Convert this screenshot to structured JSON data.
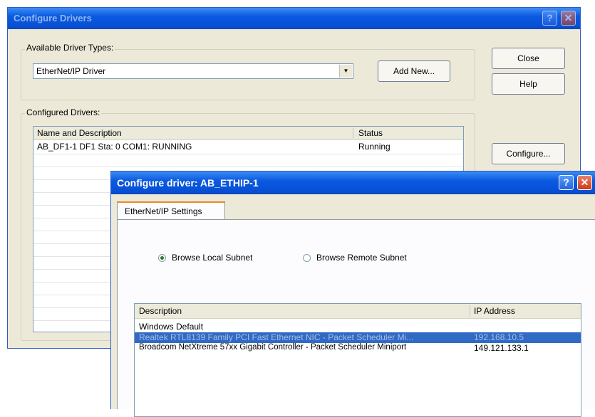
{
  "back_window": {
    "title": "Configure Drivers",
    "available_label": "Available Driver Types:",
    "driver_type_value": "EtherNet/IP Driver",
    "add_new_label": "Add New...",
    "close_label": "Close",
    "help_label": "Help",
    "configured_label": "Configured Drivers:",
    "col_name": "Name and Description",
    "col_status": "Status",
    "rows": [
      {
        "name": "AB_DF1-1 DF1 Sta: 0 COM1: RUNNING",
        "status": "Running"
      }
    ],
    "configure_label": "Configure..."
  },
  "front_window": {
    "title": "Configure driver: AB_ETHIP-1",
    "tab_label": "EtherNet/IP Settings",
    "radio_local": "Browse Local Subnet",
    "radio_remote": "Browse Remote Subnet",
    "selected_radio": "local",
    "col_description": "Description",
    "col_ip": "IP Address",
    "rows": [
      {
        "description": "Windows Default",
        "ip": "",
        "selected": false
      },
      {
        "description": "Realtek RTL8139 Family PCI Fast Ethernet NIC - Packet Scheduler Mi...",
        "ip": "192.168.10.5",
        "selected": true
      },
      {
        "description": "Broadcom NetXtreme 57xx Gigabit Controller - Packet Scheduler Miniport",
        "ip": "149.121.133.1",
        "selected": false
      }
    ]
  },
  "colors": {
    "title_blue": "#0a5ae0",
    "selection": "#316ac5",
    "window_bg": "#ece9d8"
  }
}
